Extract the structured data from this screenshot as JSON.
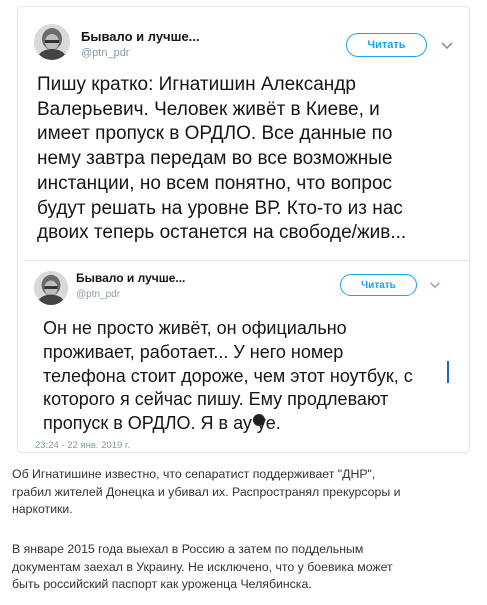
{
  "tweets": [
    {
      "author": "Бывало и лучше...",
      "handle": "@ptn_pdr",
      "follow_label": "Читать",
      "text_lines": [
        "Пишу кратко: Игнатишин Александр",
        "Валерьевич. Человек живёт в Киеве, и",
        "имеет пропуск в ОРДЛО. Все данные по",
        "нему завтра передам во все возможные",
        "инстанции, но всем понятно, что вопрос",
        "будут решать на уровне ВР. Кто-то из нас",
        "двоих теперь останется на свободе/жив..."
      ]
    },
    {
      "author": "Бывало и лучше...",
      "handle": "@ptn_pdr",
      "follow_label": "Читать",
      "text_lines": [
        "Он не просто живёт, он официально",
        "проживает, работает... У него номер",
        "телефона стоит дороже, чем этот ноутбук, с",
        "которого я сейчас пишу. Ему продлевают",
        "пропуск в ОРДЛО. Я в ау  уе."
      ],
      "timestamp": "23:24 - 22 янв. 2019 г."
    }
  ],
  "icons": {
    "chevron": "chevron-down-icon",
    "avatar": "avatar"
  },
  "colors": {
    "accent": "#1da1f2",
    "muted": "#8899a6",
    "border": "#e1e8ed"
  },
  "article": {
    "paragraph1": [
      "Об Игнатишине известно, что сепаратист поддерживает \"ДНР\",",
      "грабил жителей Донецка и убивал их. Распространял прекурсоры и",
      "наркотики."
    ],
    "paragraph2": [
      "В январе 2015 года выехал в Россию а затем по поддельным",
      "документам заехал в Украину. Не исключено, что у боевика может",
      "быть российский паспорт как уроженца Челябинска."
    ]
  }
}
